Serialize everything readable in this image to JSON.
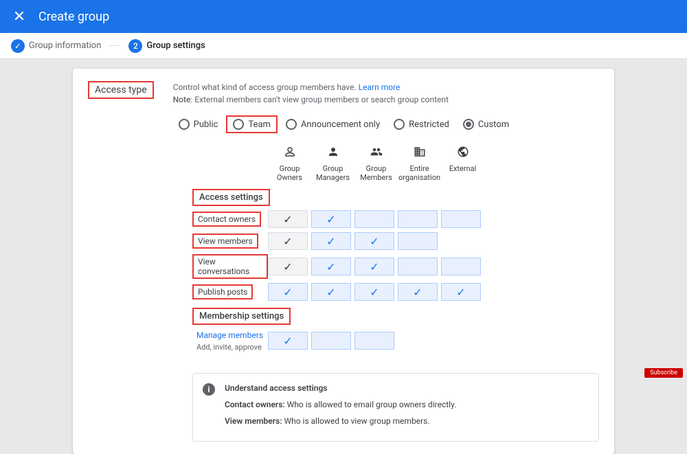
{
  "header": {
    "title": "Create group"
  },
  "stepper": {
    "step1": "Group information",
    "step2_num": "2",
    "step2": "Group settings"
  },
  "accessType": {
    "label": "Access type",
    "desc1": "Control what kind of access group members have. ",
    "learnMore": "Learn more",
    "note_prefix": "Note",
    "note_rest": ": External members can't view group members or search group content"
  },
  "radios": {
    "public": "Public",
    "team": "Team",
    "announcement": "Announcement only",
    "restricted": "Restricted",
    "custom": "Custom"
  },
  "columns": {
    "c1a": "Group",
    "c1b": "Owners",
    "c2a": "Group",
    "c2b": "Managers",
    "c3a": "Group",
    "c3b": "Members",
    "c4a": "Entire",
    "c4b": "organisation",
    "c5a": "External",
    "c5b": ""
  },
  "sections": {
    "accessSettings": "Access settings",
    "membershipSettings": "Membership settings"
  },
  "rows": {
    "contactOwners": "Contact owners",
    "viewMembers": "View members",
    "viewConversations": "View conversations",
    "publishPosts": "Publish posts",
    "manageMembers": "Manage members",
    "manageMembersSub": "Add, invite, approve"
  },
  "info": {
    "title": "Understand access settings",
    "line1_b": "Contact owners:",
    "line1": " Who is allowed to email group owners directly.",
    "line2_b": "View members:",
    "line2": " Who is allowed to view group members."
  },
  "subscribe": "Subscribe"
}
